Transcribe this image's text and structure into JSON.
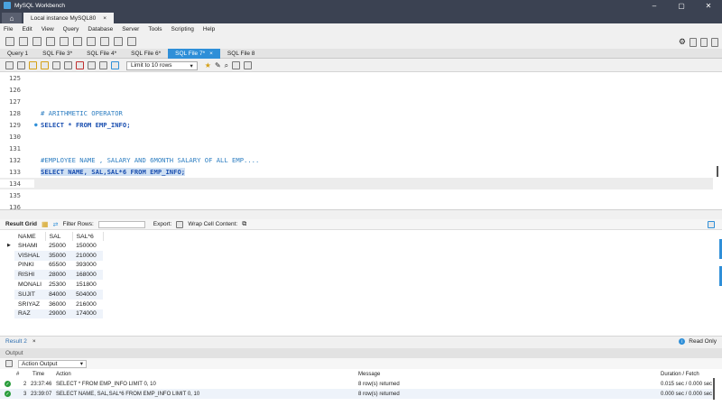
{
  "app": {
    "title": "MySQL Workbench",
    "connection_tab": "Local instance MySQL80",
    "close": "×"
  },
  "window": {
    "minimize": "–",
    "maximize": "▢",
    "close": "✕"
  },
  "menu": [
    "File",
    "Edit",
    "View",
    "Query",
    "Database",
    "Server",
    "Tools",
    "Scripting",
    "Help"
  ],
  "sql_tabs": [
    {
      "label": "Query 1",
      "active": false
    },
    {
      "label": "SQL File 3*",
      "active": false
    },
    {
      "label": "SQL File 4*",
      "active": false
    },
    {
      "label": "SQL File 6*",
      "active": false
    },
    {
      "label": "SQL File 7*",
      "active": true,
      "close": "×"
    },
    {
      "label": "SQL File 8",
      "active": false
    }
  ],
  "limit": {
    "label": "Limit to 10 rows",
    "arrow": "▾"
  },
  "editor": {
    "lines": [
      {
        "num": "125",
        "text": ""
      },
      {
        "num": "126",
        "text": ""
      },
      {
        "num": "127",
        "text": ""
      },
      {
        "num": "128",
        "text": "# ARITHMETIC OPERATOR"
      },
      {
        "num": "129",
        "text": "SELECT * FROM EMP_INFO;"
      },
      {
        "num": "130",
        "text": ""
      },
      {
        "num": "131",
        "text": ""
      },
      {
        "num": "132",
        "text": "#EMPLOYEE NAME , SALARY AND 6MONTH SALARY OF ALL EMP...."
      },
      {
        "num": "133",
        "text": "SELECT NAME, SAL,SAL*6 FROM EMP_INFO;"
      },
      {
        "num": "134",
        "text": ""
      },
      {
        "num": "135",
        "text": ""
      },
      {
        "num": "136",
        "text": ""
      }
    ]
  },
  "result_toolbar": {
    "result_grid": "Result Grid",
    "filter_rows": "Filter Rows:",
    "export": "Export:",
    "wrap": "Wrap Cell Content:"
  },
  "result_grid": {
    "columns": [
      "NAME",
      "SAL",
      "SAL*6"
    ],
    "rows": [
      [
        "SHAMI",
        "25000",
        "150000"
      ],
      [
        "VISHAL",
        "35000",
        "210000"
      ],
      [
        "PINKI",
        "65500",
        "393000"
      ],
      [
        "RISHI",
        "28000",
        "168000"
      ],
      [
        "MONALI",
        "25300",
        "151800"
      ],
      [
        "SUJIT",
        "84000",
        "504000"
      ],
      [
        "SRIYAZ",
        "36000",
        "216000"
      ],
      [
        "RAZ",
        "29000",
        "174000"
      ]
    ],
    "row_marker": "▶"
  },
  "result_tabs": {
    "label": "Result 2",
    "close": "×",
    "read_only": "Read Only"
  },
  "output": {
    "header": "Output",
    "selector": "Action Output",
    "arrow": "▾",
    "columns": {
      "num": "#",
      "time": "Time",
      "action": "Action",
      "message": "Message",
      "duration": "Duration / Fetch"
    },
    "rows": [
      {
        "num": "2",
        "time": "23:37:46",
        "action": "SELECT * FROM EMP_INFO LIMIT 0, 10",
        "message": "8 row(s) returned",
        "duration": "0.015 sec / 0.000 sec"
      },
      {
        "num": "3",
        "time": "23:39:07",
        "action": "SELECT NAME, SAL,SAL*6 FROM EMP_INFO LIMIT 0, 10",
        "message": "8 row(s) returned",
        "duration": "0.000 sec / 0.000 sec"
      }
    ]
  }
}
